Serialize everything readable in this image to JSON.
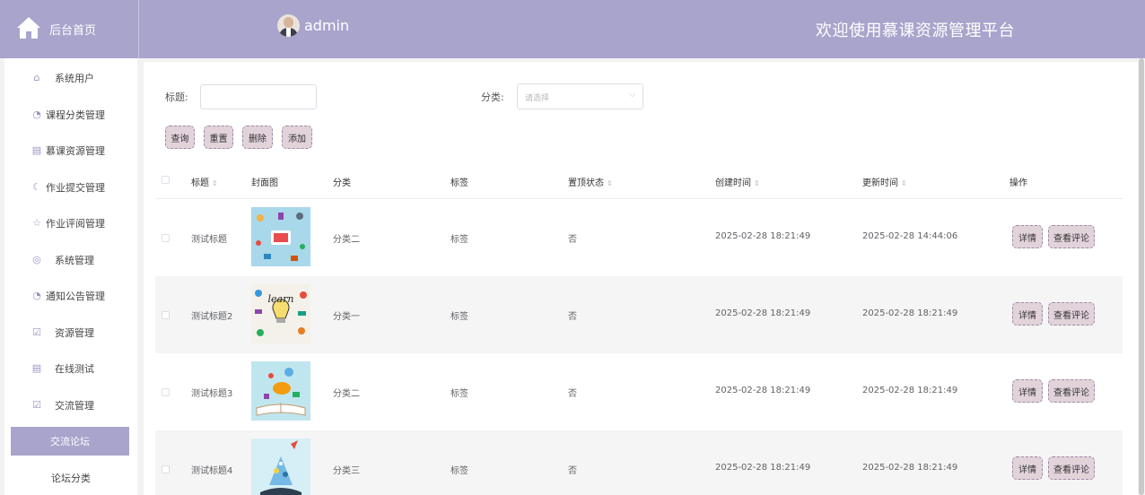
{
  "header": {
    "home_label": "后台首页",
    "username": "admin",
    "platform_title": "欢迎使用慕课资源管理平台",
    "accent_color": "#a9a4cc"
  },
  "sidebar": {
    "items": [
      {
        "label": "系统用户",
        "icon": "home-outline-icon"
      },
      {
        "label": "课程分类管理",
        "icon": "clock-icon"
      },
      {
        "label": "慕课资源管理",
        "icon": "box-icon"
      },
      {
        "label": "作业提交管理",
        "icon": "moon-icon"
      },
      {
        "label": "作业评阅管理",
        "icon": "star-icon"
      },
      {
        "label": "系统管理",
        "icon": "compass-icon"
      },
      {
        "label": "通知公告管理",
        "icon": "clock-icon"
      },
      {
        "label": "资源管理",
        "icon": "check-square-icon"
      },
      {
        "label": "在线测试",
        "icon": "box-icon"
      },
      {
        "label": "交流管理",
        "icon": "check-square-icon"
      }
    ],
    "active_item": "交流论坛",
    "sub_item": "论坛分类"
  },
  "filters": {
    "title_label": "标题:",
    "title_value": "",
    "category_label": "分类:",
    "category_placeholder": "请选择"
  },
  "actions": {
    "query": "查询",
    "reset": "重置",
    "delete": "删除",
    "add": "添加"
  },
  "table": {
    "columns": {
      "title": "标题",
      "cover": "封面图",
      "category": "分类",
      "tag": "标签",
      "pinned": "置顶状态",
      "created": "创建时间",
      "updated": "更新时间",
      "ops": "操作"
    },
    "rows": [
      {
        "title": "测试标题",
        "category": "分类二",
        "tag": "标签",
        "pinned": "否",
        "created": "2025-02-28 18:21:49",
        "updated": "2025-02-28 14:44:06",
        "detail": "详情",
        "comments": "查看评论"
      },
      {
        "title": "测试标题2",
        "category": "分类一",
        "tag": "标签",
        "pinned": "否",
        "created": "2025-02-28 18:21:49",
        "updated": "2025-02-28 18:21:49",
        "detail": "详情",
        "comments": "查看评论"
      },
      {
        "title": "测试标题3",
        "category": "分类二",
        "tag": "标签",
        "pinned": "否",
        "created": "2025-02-28 18:21:49",
        "updated": "2025-02-28 18:21:49",
        "detail": "详情",
        "comments": "查看评论"
      },
      {
        "title": "测试标题4",
        "category": "分类三",
        "tag": "标签",
        "pinned": "否",
        "created": "2025-02-28 18:21:49",
        "updated": "2025-02-28 18:21:49",
        "detail": "详情",
        "comments": "查看评论"
      }
    ]
  }
}
